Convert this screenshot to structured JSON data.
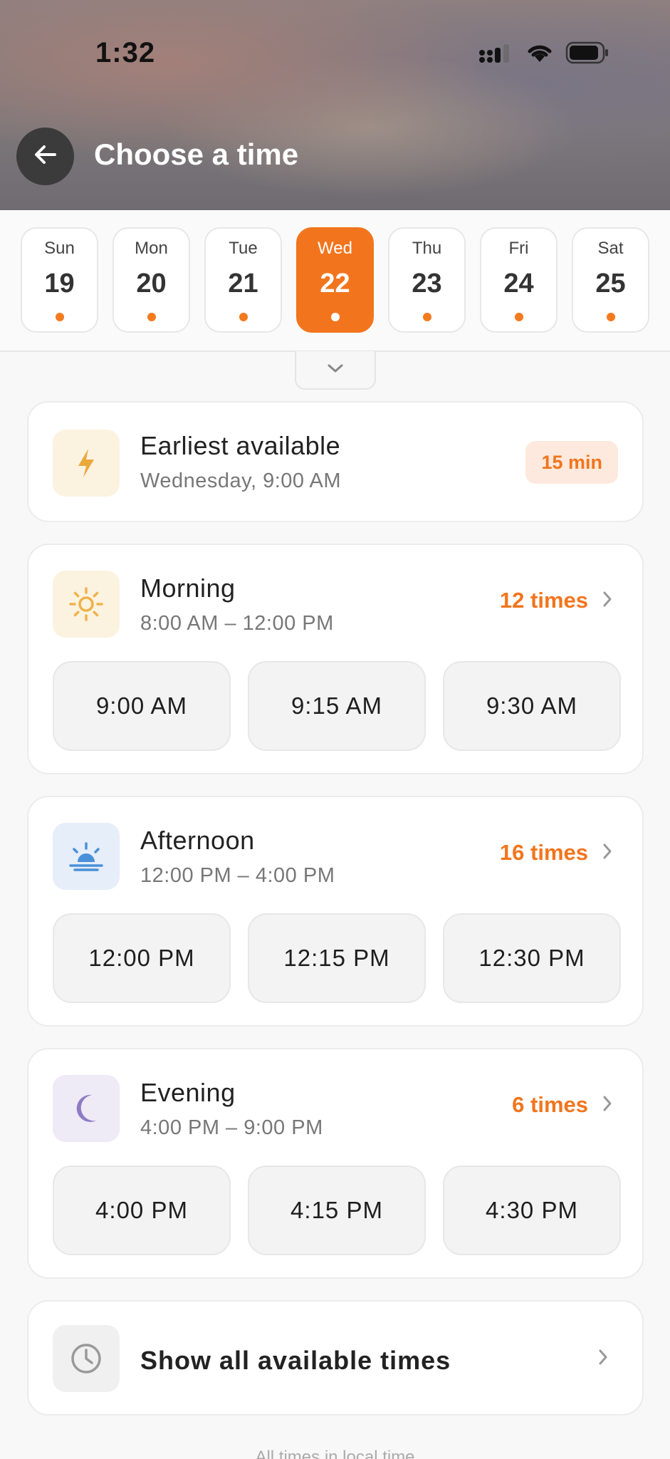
{
  "status_bar": {
    "time": "1:32"
  },
  "header": {
    "title": "Choose a time"
  },
  "days": [
    {
      "name": "Sun",
      "num": "19",
      "selected": false
    },
    {
      "name": "Mon",
      "num": "20",
      "selected": false
    },
    {
      "name": "Tue",
      "num": "21",
      "selected": false
    },
    {
      "name": "Wed",
      "num": "22",
      "selected": true
    },
    {
      "name": "Thu",
      "num": "23",
      "selected": false
    },
    {
      "name": "Fri",
      "num": "24",
      "selected": false
    },
    {
      "name": "Sat",
      "num": "25",
      "selected": false
    }
  ],
  "earliest": {
    "title": "Earliest available",
    "subtitle": "Wednesday, 9:00 AM",
    "badge": "15 min"
  },
  "periods": [
    {
      "title": "Morning",
      "range": "8:00 AM – 12:00 PM",
      "count": "12 times",
      "slots": [
        "9:00 AM",
        "9:15 AM",
        "9:30 AM"
      ]
    },
    {
      "title": "Afternoon",
      "range": "12:00 PM – 4:00 PM",
      "count": "16 times",
      "slots": [
        "12:00 PM",
        "12:15 PM",
        "12:30 PM"
      ]
    },
    {
      "title": "Evening",
      "range": "4:00 PM – 9:00 PM",
      "count": "6 times",
      "slots": [
        "4:00 PM",
        "4:15 PM",
        "4:30 PM"
      ]
    }
  ],
  "show_all": {
    "label": "Show all available times"
  },
  "footer": {
    "note": "All times in local time"
  },
  "colors": {
    "accent": "#f2751d",
    "morning_icon": "#f0b24a",
    "afternoon_icon": "#4a90d9",
    "evening_icon": "#8d7cc4"
  }
}
